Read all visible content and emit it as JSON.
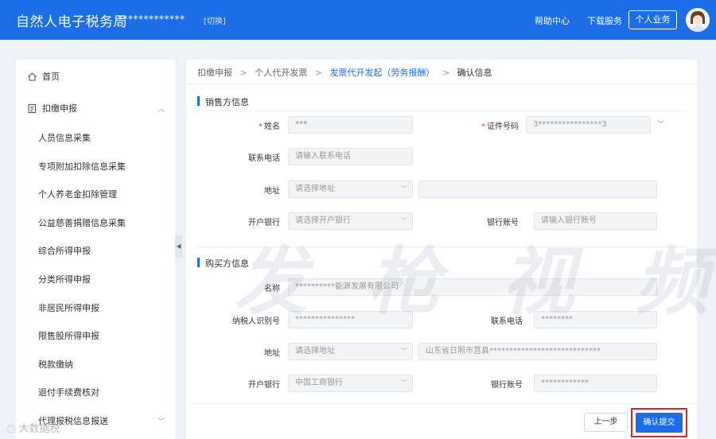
{
  "header": {
    "title": "自然人电子税务局",
    "user_masked": "*************",
    "switch_label": "[切换]",
    "help_label": "帮助中心",
    "download_label": "下载服务",
    "personal_label": "个人业务"
  },
  "sidebar": {
    "home": "首页",
    "withholding": "扣缴申报",
    "items": [
      "人员信息采集",
      "专项附加扣除信息采集",
      "个人养老金扣除管理",
      "公益慈善捐赠信息采集",
      "综合所得申报",
      "分类所得申报",
      "非居民所得申报",
      "限售股所得申报",
      "税款缴纳",
      "退付手续费核对",
      "代理报税信息报送"
    ]
  },
  "breadcrumb": {
    "items": [
      "扣缴申报",
      "个人代开发票",
      "发票代开发起（劳务报酬）",
      "确认信息"
    ]
  },
  "seller": {
    "section_title": "销售方信息",
    "name_label": "姓名",
    "name_value": "***",
    "id_label": "证件号码",
    "id_value": "3****************3",
    "phone_label": "联系电话",
    "phone_placeholder": "请输入联系电话",
    "address_label": "地址",
    "address_placeholder": "请选择地址",
    "bank_label": "开户银行",
    "bank_placeholder": "请选择开户银行",
    "account_label": "银行账号",
    "account_placeholder": "请输入银行账号"
  },
  "buyer": {
    "section_title": "购买方信息",
    "name_label": "名称",
    "name_value": "**********能源发展有限公司",
    "tax_id_label": "纳税人识别号",
    "tax_id_value": "***************",
    "phone_label": "联系电话",
    "phone_value": "********",
    "address_label": "地址",
    "address_placeholder": "请选择地址",
    "address_detail": "山东省日照市莒县****************************",
    "bank_label": "开户银行",
    "bank_value": "中国工商银行",
    "account_label": "银行账号",
    "account_value": "************"
  },
  "buttons": {
    "prev": "上一步",
    "submit": "确认提交"
  },
  "watermark": {
    "center": "发 枪 视 频",
    "corner": "大数据税"
  },
  "colors": {
    "header_bg": "#1b6ee8",
    "accent": "#1b6ee8",
    "highlight_border": "#e02424",
    "required": "#e4393c"
  },
  "icons": {
    "home": "home-icon",
    "withholding": "document-icon",
    "collapse": "chevron-left-icon"
  }
}
